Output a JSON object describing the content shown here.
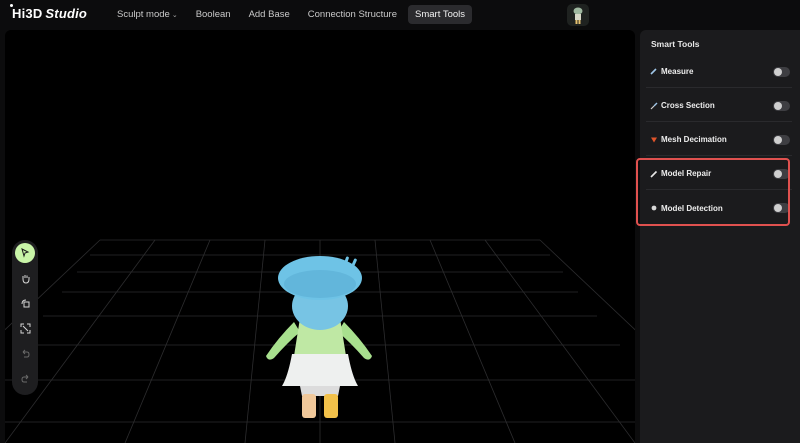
{
  "app": {
    "logo_main": "Hi3D",
    "logo_sub": "Studio"
  },
  "menu": [
    {
      "label": "Sculpt mode",
      "has_dropdown": true,
      "active": false
    },
    {
      "label": "Boolean",
      "active": false
    },
    {
      "label": "Add Base",
      "active": false
    },
    {
      "label": "Connection Structure",
      "active": false
    },
    {
      "label": "Smart Tools",
      "active": true
    }
  ],
  "toolbar": [
    {
      "name": "select-tool",
      "icon": "cursor-arrow-icon",
      "active": true
    },
    {
      "name": "pan-tool",
      "icon": "hand-icon"
    },
    {
      "name": "rotate-tool",
      "icon": "rotate-icon"
    },
    {
      "name": "fit-view-tool",
      "icon": "expand-icon"
    },
    {
      "name": "undo-tool",
      "icon": "undo-icon",
      "disabled": true
    },
    {
      "name": "redo-tool",
      "icon": "redo-icon",
      "disabled": true
    }
  ],
  "panel": {
    "title": "Smart Tools",
    "items": [
      {
        "label": "Measure",
        "icon": "ruler-icon",
        "enabled": false
      },
      {
        "label": "Cross Section",
        "icon": "knife-icon",
        "enabled": false
      },
      {
        "label": "Mesh Decimation",
        "icon": "triangle-icon",
        "enabled": false
      },
      {
        "label": "Model Repair",
        "icon": "pencil-icon",
        "enabled": false
      },
      {
        "label": "Model Detection",
        "icon": "dot-icon",
        "enabled": false
      }
    ]
  },
  "colors": {
    "accent_green": "#c9f5a8",
    "highlight_red": "#e0514f",
    "decimation_orange": "#e0542a",
    "model_hat_blue": "#6ec3e6"
  }
}
